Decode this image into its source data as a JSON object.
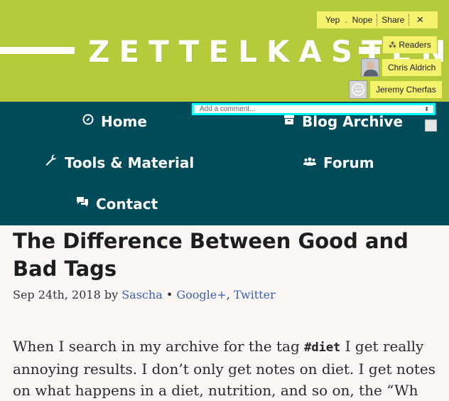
{
  "site": {
    "logo": "ZETTELKASTEN"
  },
  "overlay": {
    "yep": "Yep",
    "dot": ".",
    "nope": "Nope",
    "share": "Share",
    "close": "×",
    "readers_icon": "⁂",
    "readers": "Readers",
    "users": [
      "Chris Aldrich",
      "Jeremy Cherfas"
    ],
    "comment_placeholder": "Add a comment...",
    "comment_arrow": "⬍"
  },
  "nav": {
    "home": "Home",
    "blog_archive": "Blog Archive",
    "tools": "Tools & Material",
    "forum": "Forum",
    "contact": "Contact"
  },
  "article": {
    "title": "The Difference Between Good and Bad Tags",
    "date": "Sep 24th, 2018",
    "by": "by",
    "author": "Sascha",
    "bullet": "•",
    "google": "Google+",
    "comma": ",",
    "twitter": "Twitter",
    "p1_a": "When I search in my archive for the tag ",
    "p1_tag": "#diet",
    "p1_b": " I get really annoying results. I don’t only get notes on diet. I get notes on what happens in a diet, nutrition, and so on, the “Wh"
  },
  "colors": {
    "header_bg": "#b5cb3a",
    "nav_bg": "#004b5a",
    "page_bg": "#faf6f3",
    "overlay_bg": "#f5f36e",
    "link": "#3b5fb5",
    "focus": "#00ffff"
  },
  "icons": {
    "home": "compass-icon",
    "archive": "archive-icon",
    "tools": "wrench-icon",
    "forum": "users-icon",
    "contact": "comments-icon"
  }
}
